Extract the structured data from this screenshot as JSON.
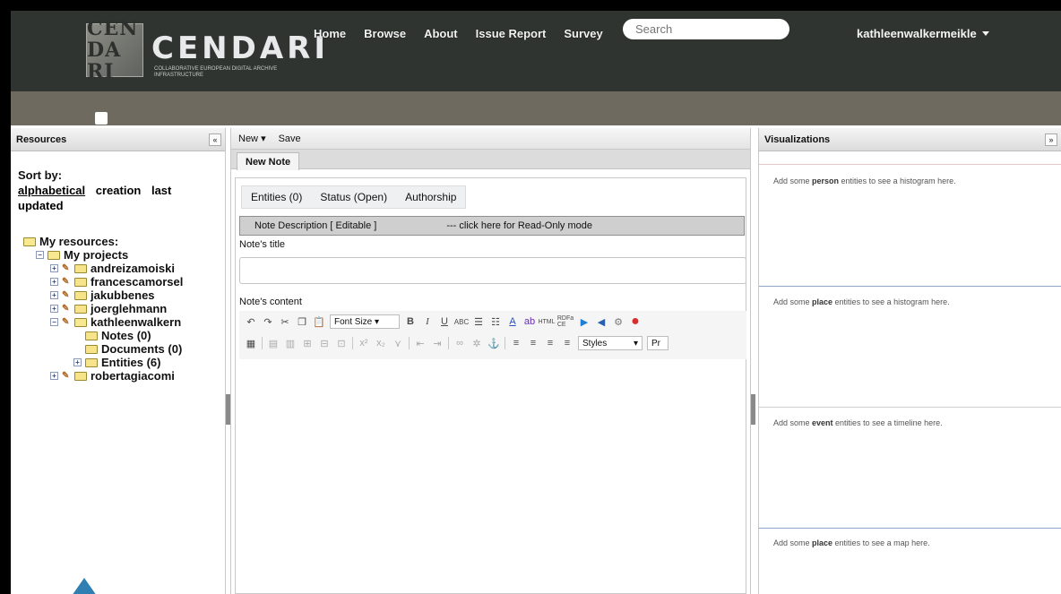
{
  "header": {
    "logo_text": "CENDARI",
    "logo_mark": "CEN DA RI",
    "logo_sub": "Collaborative European Digital Archive Infrastructure",
    "nav": [
      "Home",
      "Browse",
      "About",
      "Issue Report",
      "Survey"
    ],
    "search_placeholder": "Search",
    "user": "kathleenwalkermeikle"
  },
  "left": {
    "title": "Resources",
    "collapse": "«",
    "sort_label": "Sort by:",
    "sort_options": [
      "alphabetical",
      "creation",
      "last updated"
    ],
    "tree": {
      "root": "My resources:",
      "projects": "My projects",
      "items": [
        "andreizamoiski",
        "francescamorsel",
        "jakubbenes",
        "joerglehmann",
        "kathleenwalkern"
      ],
      "sub": [
        "Notes (0)",
        "Documents (0)",
        "Entities (6)"
      ],
      "last": "robertagiacomi"
    }
  },
  "center": {
    "toolbar": {
      "new": "New",
      "save": "Save"
    },
    "tab": "New Note",
    "subtabs": [
      "Entities (0)",
      "Status (Open)",
      "Authorship"
    ],
    "desc_left": "Note Description [ Editable ]",
    "desc_right": "--- click here for Read-Only mode",
    "title_label": "Note's title",
    "content_label": "Note's content",
    "font_size": "Font Size",
    "styles": "Styles",
    "rdfa": "RDFa CE",
    "para_partial": "Pr"
  },
  "right": {
    "title": "Visualizations",
    "hints": [
      {
        "pre": "Add some ",
        "word": "person",
        "post": " entities to see a histogram here."
      },
      {
        "pre": "Add some ",
        "word": "place",
        "post": " entities to see a histogram here."
      },
      {
        "pre": "Add some ",
        "word": "event",
        "post": " entities to see a timeline here."
      },
      {
        "pre": "Add some ",
        "word": "place",
        "post": " entities to see a map here."
      }
    ]
  },
  "colors": {
    "header_bg": "#2f3431",
    "subbar_bg": "#6e6a60",
    "folder": "#f6e38a",
    "viz_line": "#8fa7c9",
    "record_red": "#d92c2c",
    "accent_blue": "#2f7fb3"
  }
}
